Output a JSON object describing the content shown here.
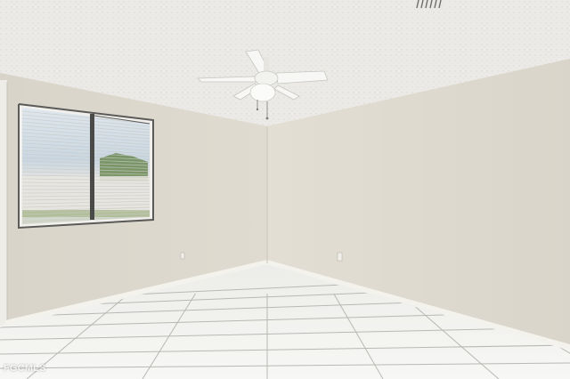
{
  "scene": {
    "subject": "empty-room",
    "colors": {
      "ceiling": "#eceae6",
      "left_wall": "#dcd8cd",
      "back_wall": "#e1ddd3",
      "right_wall": "#dfdbd1",
      "floor_tile": "#f4f4f2",
      "grout": "#b8b8b4",
      "baseboard": "#f2f1ec",
      "fan": "#f7f7f5"
    }
  },
  "watermark": {
    "text": "FGCMLS"
  }
}
